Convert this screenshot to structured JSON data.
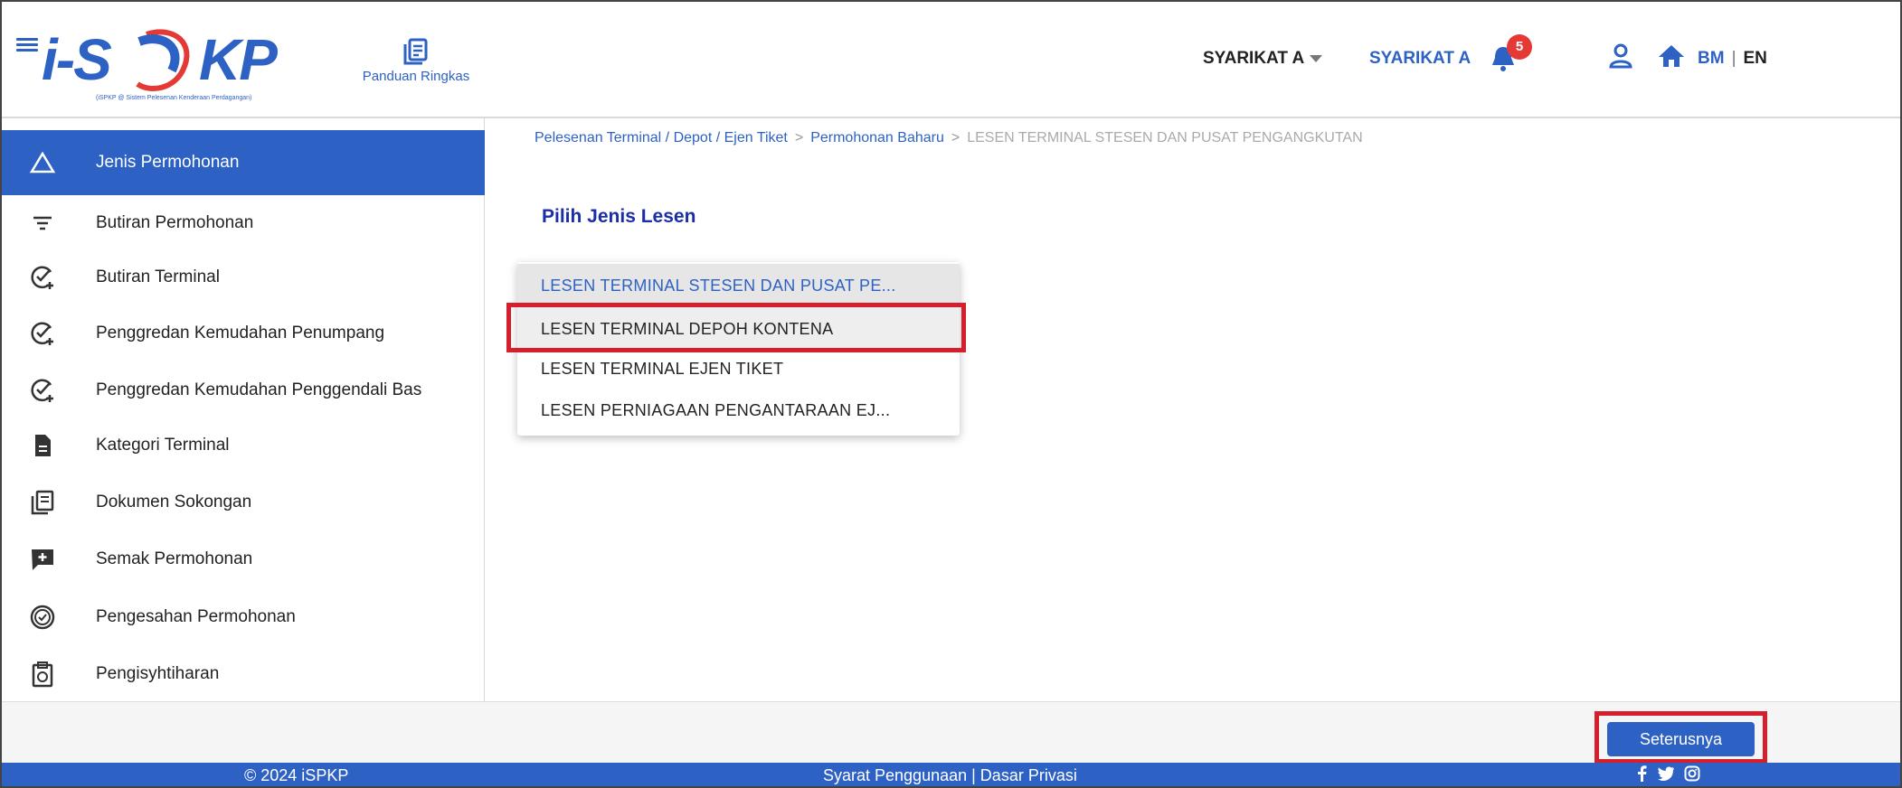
{
  "header": {
    "guide_label": "Panduan Ringkas",
    "company_select": "SYARIKAT A",
    "company_link": "SYARIKAT A",
    "notification_count": "5",
    "lang_bm": "BM",
    "lang_sep": "|",
    "lang_en": "EN",
    "logo_text": "i-SPKP",
    "logo_subtitle": "(iSPKP @ Sistem Pelesenan Kenderaan Perdagangan)"
  },
  "sidebar": {
    "items": [
      {
        "label": "Jenis Permohonan",
        "icon": "triangle-icon"
      },
      {
        "label": "Butiran Permohonan",
        "icon": "filter-icon"
      },
      {
        "label": "Butiran Terminal",
        "icon": "check-plus-icon"
      },
      {
        "label": "Penggredan Kemudahan Penumpang",
        "icon": "check-plus-icon"
      },
      {
        "label": "Penggredan Kemudahan Penggendali Bas",
        "icon": "check-plus-icon"
      },
      {
        "label": "Kategori Terminal",
        "icon": "document-icon"
      },
      {
        "label": "Dokumen Sokongan",
        "icon": "documents-icon"
      },
      {
        "label": "Semak Permohonan",
        "icon": "chat-plus-icon"
      },
      {
        "label": "Pengesahan Permohonan",
        "icon": "verified-icon"
      },
      {
        "label": "Pengisyhtiharan",
        "icon": "clipboard-icon"
      }
    ]
  },
  "breadcrumb": {
    "item1": "Pelesenan Terminal / Depot / Ejen Tiket",
    "sep": ">",
    "item2": "Permohonan Baharu",
    "current": "LESEN TERMINAL STESEN DAN PUSAT PENGANGKUTAN"
  },
  "main": {
    "section_title": "Pilih Jenis Lesen",
    "options": [
      "LESEN TERMINAL STESEN DAN PUSAT PE...",
      "LESEN TERMINAL DEPOH KONTENA",
      "LESEN TERMINAL EJEN TIKET",
      "LESEN PERNIAGAAN PENGANTARAAN EJ..."
    ],
    "next_label": "Seterusnya"
  },
  "footer": {
    "copyright": "© 2024 iSPKP",
    "links": "Syarat Penggunaan | Dasar Privasi",
    "social_icons": [
      "facebook-icon",
      "twitter-icon",
      "instagram-icon"
    ]
  },
  "colors": {
    "primary": "#2d62c4",
    "highlight": "#d61f2c",
    "badge": "#e53935",
    "title": "#1a2ea8"
  }
}
